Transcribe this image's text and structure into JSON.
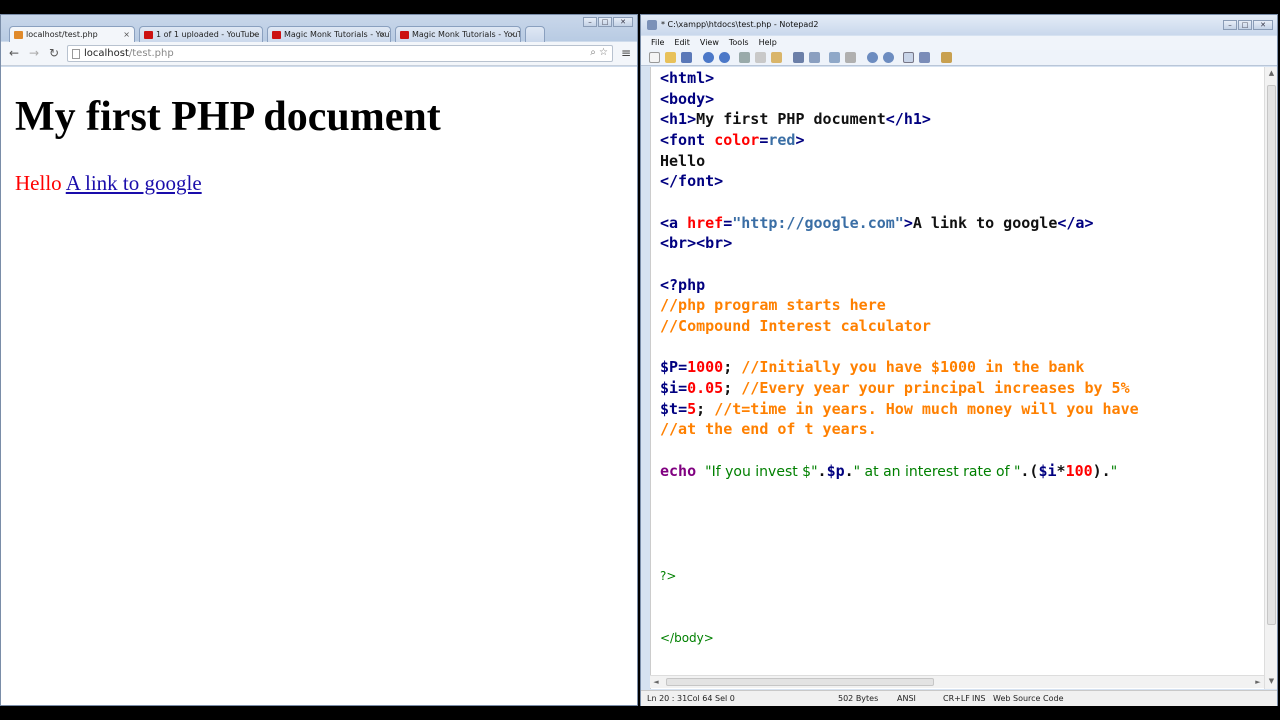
{
  "browser": {
    "tabs": [
      {
        "label": "localhost/test.php",
        "favicon_color": "#e08a2b",
        "active": true
      },
      {
        "label": "1 of 1 uploaded - YouTube",
        "favicon_color": "#cc1111",
        "active": false
      },
      {
        "label": "Magic Monk Tutorials - YouTube",
        "favicon_color": "#cc1111",
        "active": false
      },
      {
        "label": "Magic Monk Tutorials - YouTube",
        "favicon_color": "#cc1111",
        "active": false
      }
    ],
    "tab_close": "×",
    "nav": {
      "back": "←",
      "forward": "→",
      "reload": "↻",
      "menu": "≡"
    },
    "url": {
      "host": "localhost",
      "path": "/test.php"
    },
    "omnibox_tools": "⌕ ☆",
    "page": {
      "heading": "My first PHP document",
      "hello": "Hello",
      "link": "A link to google"
    }
  },
  "notepad": {
    "title": "* C:\\xampp\\htdocs\\test.php - Notepad2",
    "menu": [
      "File",
      "Edit",
      "View",
      "Tools",
      "Help"
    ],
    "window_buttons": {
      "minimize": "–",
      "maximize": "□",
      "close": "✕"
    },
    "code": {
      "l1": "<html>",
      "l2": "<body>",
      "l3_open": "<h1>",
      "l3_text": "My first PHP document",
      "l3_close": "</h1>",
      "l4_open": "<font ",
      "l4_attr": "color",
      "l4_eq": "=",
      "l4_val": "red",
      "l4_close": ">",
      "l5": "Hello",
      "l6": "</font>",
      "l8_open": "<a ",
      "l8_attr": "href",
      "l8_eq": "=",
      "l8_val": "\"http://google.com\"",
      "l8_gt": ">",
      "l8_text": "A link to google",
      "l8_close": "</a>",
      "l9": "<br><br>",
      "l11": "<?php",
      "l12": "//php program starts here",
      "l13": "//Compound Interest calculator",
      "l15_var": "$P",
      "l15_eq": "=",
      "l15_num": "1000",
      "l15_semi": "; ",
      "l15_cmt": "//Initially you have $1000 in the bank",
      "l16_var": "$i",
      "l16_eq": "=",
      "l16_num": "0.05",
      "l16_semi": "; ",
      "l16_cmt": "//Every year your principal increases by 5%",
      "l17_var": "$t",
      "l17_eq": "=",
      "l17_num": "5",
      "l17_semi": "; ",
      "l17_cmt": "//t=time in years. How much money will you have",
      "l18": "//at the end of t years.",
      "l20_kw": "echo ",
      "l20_s1": "\"If you invest $\"",
      "l20_dot1": ".",
      "l20_var": "$p",
      "l20_dot2": ".",
      "l20_s2": "\" at an interest rate of \"",
      "l20_dot3": ".(",
      "l20_var2": "$i",
      "l20_mul": "*",
      "l20_num": "100",
      "l20_paren": ").",
      "l20_s3": "\"",
      "l25": "?>",
      "l28": "</body>"
    },
    "status": {
      "pos": "Ln 20 : 31",
      "col": "Col 64",
      "sel": "Sel 0",
      "size": "502 Bytes",
      "encoding": "ANSI",
      "eol": "CR+LF",
      "ins": "INS",
      "scheme": "Web Source Code"
    },
    "scroll_arrows": {
      "up": "▲",
      "down": "▼",
      "left": "◄",
      "right": "►"
    }
  }
}
